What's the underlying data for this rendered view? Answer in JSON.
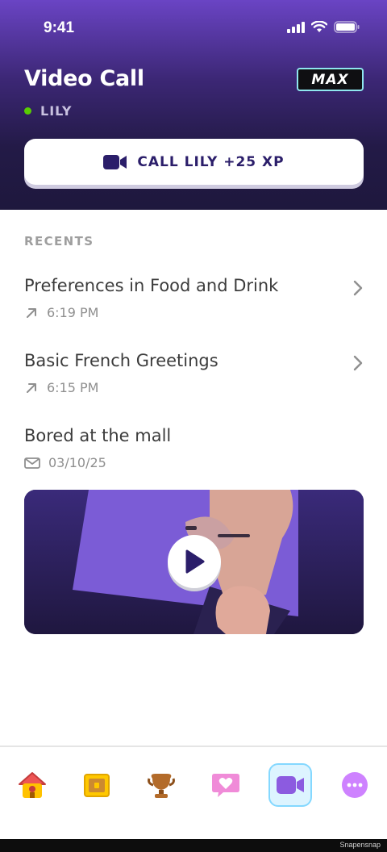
{
  "status_bar": {
    "time": "9:41"
  },
  "header": {
    "title": "Video Call",
    "badge": "MAX",
    "contact_name": "LILY",
    "call_button_label": "CALL LILY +25 XP"
  },
  "recents": {
    "section_title": "RECENTS",
    "items": [
      {
        "title": "Preferences in Food and Drink",
        "meta": "6:19 PM",
        "icon": "outgoing-arrow-icon"
      },
      {
        "title": "Basic French Greetings",
        "meta": "6:15 PM",
        "icon": "outgoing-arrow-icon"
      },
      {
        "title": "Bored at the mall",
        "meta": "03/10/25",
        "icon": "envelope-icon"
      }
    ]
  },
  "tabs": [
    {
      "name": "home",
      "icon": "home-icon"
    },
    {
      "name": "chest",
      "icon": "treasure-chest-icon"
    },
    {
      "name": "leaderboard",
      "icon": "trophy-icon"
    },
    {
      "name": "friends",
      "icon": "heart-chat-icon"
    },
    {
      "name": "video-call",
      "icon": "video-camera-icon",
      "active": true
    },
    {
      "name": "more",
      "icon": "more-icon"
    }
  ],
  "watermark": "Snapensnap",
  "colors": {
    "header_top": "#6a44c4",
    "header_bottom": "#1e183d",
    "call_text": "#2b1e6a",
    "online": "#58cc02",
    "active_tab_bg": "#ddf4ff",
    "active_tab_border": "#84d8ff"
  }
}
